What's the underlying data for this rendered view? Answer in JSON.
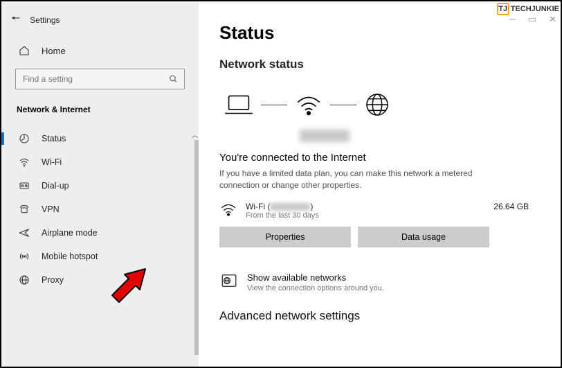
{
  "watermark": "TECHJUNKIE",
  "header": {
    "back": "←",
    "title": "Settings"
  },
  "home_label": "Home",
  "search_placeholder": "Find a setting",
  "section_title": "Network & Internet",
  "nav": [
    {
      "label": "Status",
      "icon": "status"
    },
    {
      "label": "Wi-Fi",
      "icon": "wifi"
    },
    {
      "label": "Dial-up",
      "icon": "dialup"
    },
    {
      "label": "VPN",
      "icon": "vpn"
    },
    {
      "label": "Airplane mode",
      "icon": "airplane"
    },
    {
      "label": "Mobile hotspot",
      "icon": "hotspot"
    },
    {
      "label": "Proxy",
      "icon": "globe"
    }
  ],
  "main": {
    "title": "Status",
    "subtitle": "Network status",
    "connected_title": "You're connected to the Internet",
    "connected_desc": "If you have a limited data plan, you can make this network a metered connection or change other properties.",
    "usage_net_label": "Wi-Fi (",
    "usage_net_close": ")",
    "usage_period": "From the last 30 days",
    "usage_amount": "26.64 GB",
    "btn_properties": "Properties",
    "btn_data_usage": "Data usage",
    "avail_title": "Show available networks",
    "avail_sub": "View the connection options around you.",
    "adv_title": "Advanced network settings"
  }
}
